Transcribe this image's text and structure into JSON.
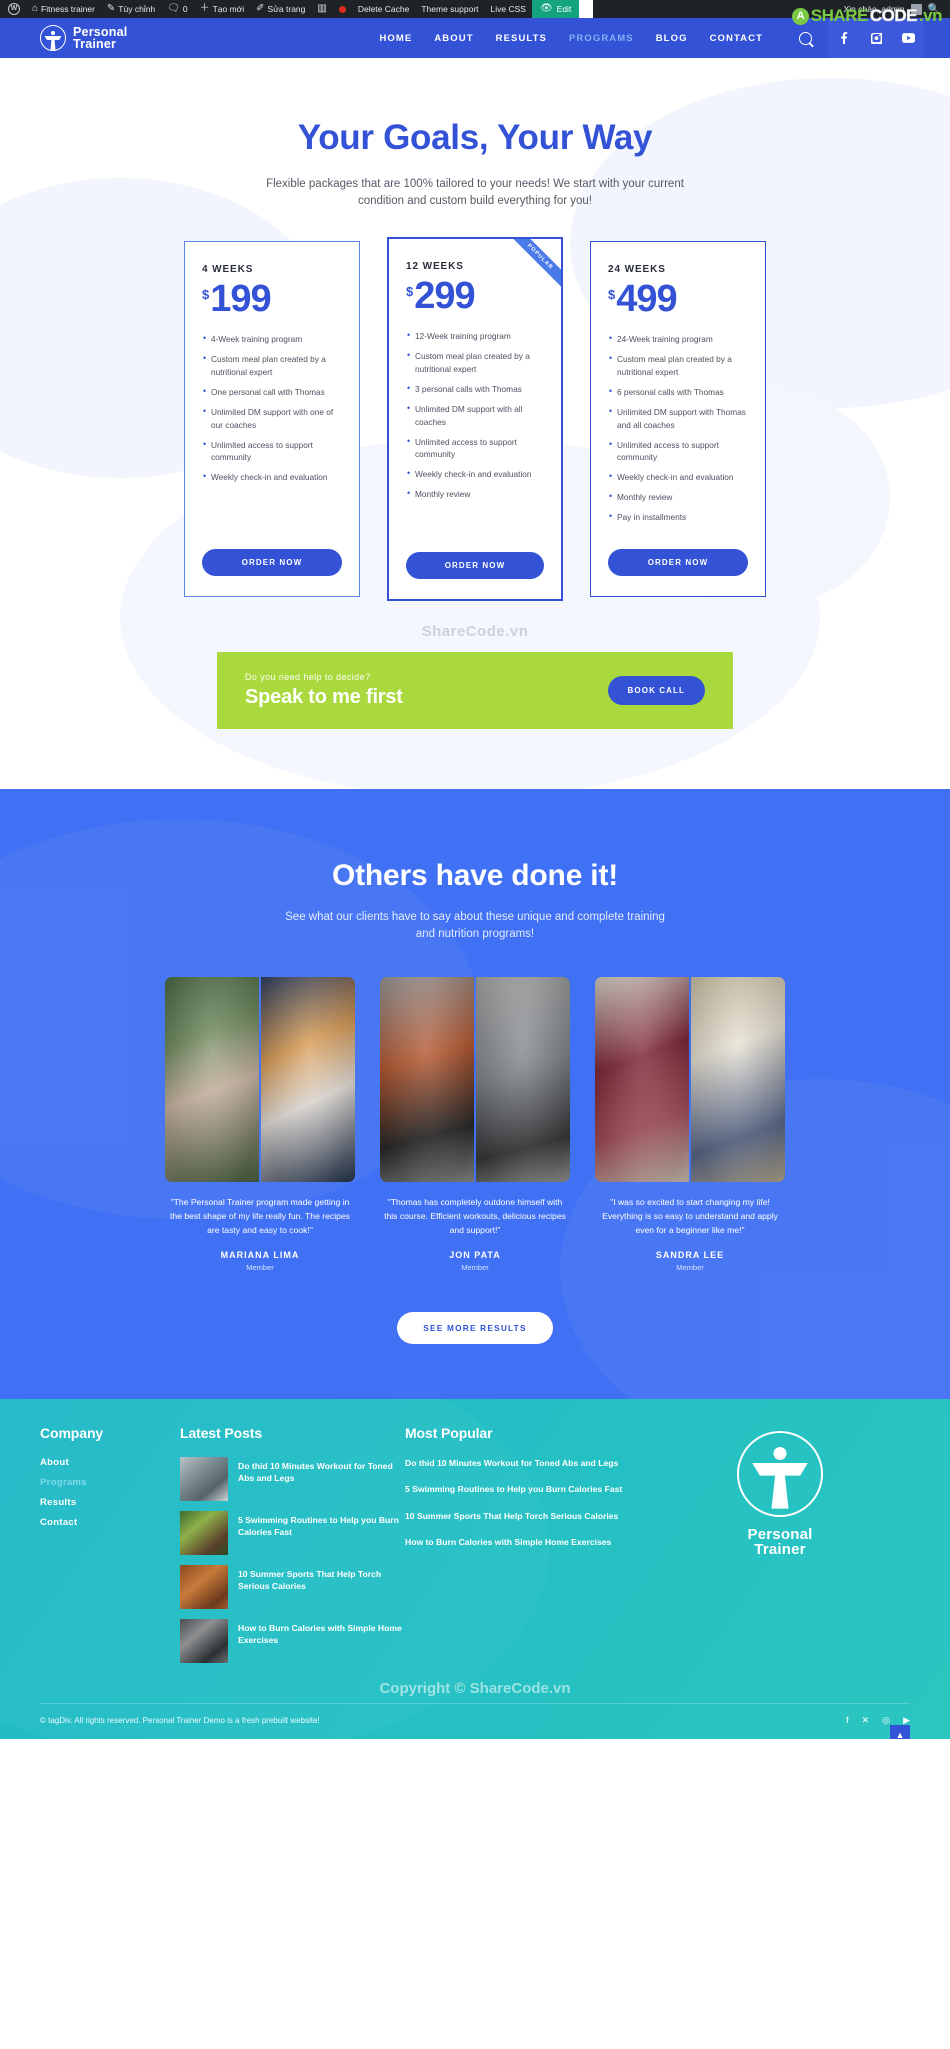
{
  "adminbar": {
    "items": [
      {
        "icon": "wordpress-logo-icon",
        "label": ""
      },
      {
        "icon": "dashboard-icon",
        "label": "Fitness trainer"
      },
      {
        "icon": "pencil-icon",
        "label": "Tùy chỉnh"
      },
      {
        "icon": "comment-icon",
        "label": "0"
      },
      {
        "icon": "plus-icon",
        "label": "Tạo mới"
      },
      {
        "icon": "edit-icon",
        "label": "Sửa trang"
      },
      {
        "icon": "wpbakery-icon",
        "label": ""
      },
      {
        "icon": "record-dot-icon",
        "label": ""
      },
      {
        "icon": "",
        "label": "Delete Cache"
      },
      {
        "icon": "",
        "label": "Theme support"
      },
      {
        "icon": "",
        "label": "Live CSS"
      }
    ],
    "edit_label": "Edit",
    "greeting": "Xin chào, admin"
  },
  "watermark": {
    "logo_letter": "A",
    "share": "SHARE",
    "code": "CODE",
    "vn": ".vn",
    "center_text": "ShareCode.vn",
    "copyright_overlay": "Copyright © ShareCode.vn"
  },
  "header": {
    "brand_line1": "Personal",
    "brand_line2": "Trainer",
    "nav": [
      {
        "label": "HOME",
        "active": false
      },
      {
        "label": "ABOUT",
        "active": false
      },
      {
        "label": "RESULTS",
        "active": false
      },
      {
        "label": "PROGRAMS",
        "active": true
      },
      {
        "label": "BLOG",
        "active": false
      },
      {
        "label": "CONTACT",
        "active": false
      }
    ],
    "social": [
      {
        "name": "facebook-icon",
        "glyph": "f"
      },
      {
        "name": "instagram-icon",
        "glyph": "◻"
      },
      {
        "name": "youtube-icon",
        "glyph": "▶"
      }
    ]
  },
  "hero": {
    "title": "Your Goals, Your Way",
    "subtitle": "Flexible packages that are 100% tailored to your needs! We start with your current condition and custom build everything for you!"
  },
  "pricing": {
    "order_label": "ORDER NOW",
    "popular_badge": "POPULAR",
    "currency": "$",
    "plans": [
      {
        "term": "4 WEEKS",
        "price": "199",
        "featured": false,
        "features": [
          "4-Week training program",
          "Custom meal plan created by a nutritional expert",
          "One personal call with Thomas",
          "Unlimited DM support with one of our coaches",
          "Unlimited access to support community",
          "Weekly check-in and evaluation"
        ]
      },
      {
        "term": "12 WEEKS",
        "price": "299",
        "featured": true,
        "features": [
          "12-Week training program",
          "Custom meal plan created by a nutritional expert",
          "3 personal calls with Thomas",
          "Unlimited DM support with all coaches",
          "Unlimited access to support community",
          "Weekly check-in and evaluation",
          "Monthly review"
        ]
      },
      {
        "term": "24 WEEKS",
        "price": "499",
        "featured": false,
        "features": [
          "24-Week training program",
          "Custom meal plan created by a nutritional expert",
          "6 personal calls with Thomas",
          "Unlimited DM support with Thomas and all coaches",
          "Unlimited access to support community",
          "Weekly check-in and evaluation",
          "Monthly review",
          "Pay in installments"
        ]
      }
    ]
  },
  "cta": {
    "kicker": "Do you need help to decide?",
    "title": "Speak to me first",
    "button": "BOOK CALL"
  },
  "testimonials": {
    "title": "Others have done it!",
    "subtitle": "See what our clients have to say about these unique and complete training and nutrition programs!",
    "see_more": "SEE MORE RESULTS",
    "items": [
      {
        "quote": "\"The Personal Trainer program made getting in the best shape of my life really fun. The recipes are tasty and easy to cook!\"",
        "name": "MARIANA LIMA",
        "role": "Member"
      },
      {
        "quote": "\"Thomas has completely outdone himself with this course. Efficient workouts, delicious recipes and support!\"",
        "name": "JON PATA",
        "role": "Member"
      },
      {
        "quote": "\"I was so excited to start changing my life! Everything is so easy to understand and apply even for a beginner like me!\"",
        "name": "SANDRA LEE",
        "role": "Member"
      }
    ]
  },
  "footer": {
    "company_title": "Company",
    "company_links": [
      {
        "label": "About",
        "active": false
      },
      {
        "label": "Programs",
        "active": true
      },
      {
        "label": "Results",
        "active": false
      },
      {
        "label": "Contact",
        "active": false
      }
    ],
    "latest_title": "Latest Posts",
    "latest_posts": [
      {
        "title": "Do thid 10 Minutes Workout for Toned Abs and Legs"
      },
      {
        "title": "5 Swimming Routines to Help you Burn Calories Fast"
      },
      {
        "title": "10 Summer Sports That Help Torch Serious Calories"
      },
      {
        "title": "How to Burn Calories with Simple Home Exercises"
      }
    ],
    "popular_title": "Most Popular",
    "popular_posts": [
      {
        "title": "Do thid 10 Minutes Workout for Toned Abs and Legs"
      },
      {
        "title": "5 Swimming Routines to Help you Burn Calories Fast"
      },
      {
        "title": "10 Summer Sports That Help Torch Serious Calories"
      },
      {
        "title": "How to Burn Calories with Simple Home Exercises"
      }
    ],
    "logo_line1": "Personal",
    "logo_line2": "Trainer",
    "copyright": "© tagDiv. All rights reserved. Personal Trainer Demo is a fresh prebuilt website!",
    "social": [
      {
        "name": "facebook-icon",
        "glyph": "f"
      },
      {
        "name": "x-twitter-icon",
        "glyph": "✕"
      },
      {
        "name": "instagram-icon",
        "glyph": "◎"
      },
      {
        "name": "youtube-icon",
        "glyph": "▶"
      }
    ],
    "to_top": "▲"
  },
  "colors": {
    "brand_blue": "#3352d6",
    "hero_blue": "#4070f4",
    "green": "#a9d93c",
    "teal": "#23bfc4"
  }
}
